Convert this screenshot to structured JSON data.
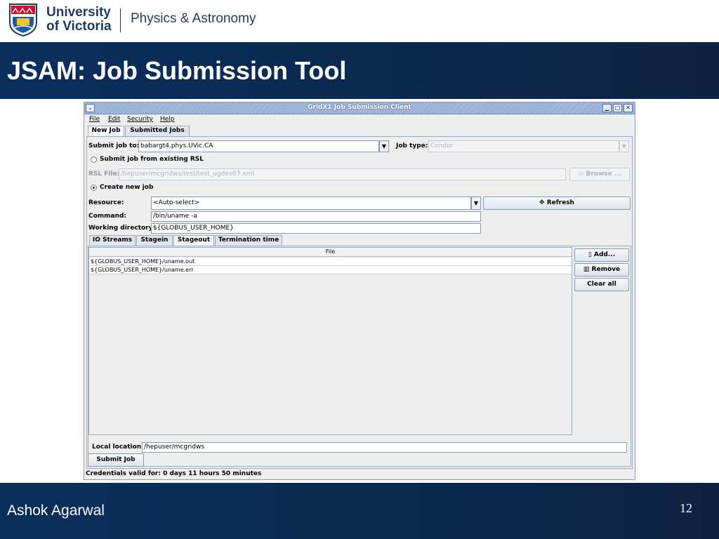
{
  "slide": {
    "logo": {
      "line1": "University",
      "line2": "of Victoria",
      "department": "Physics & Astronomy"
    },
    "title": "JSAM: Job Submission Tool",
    "presenter": "Ashok Agarwal",
    "page_number": "12",
    "colors": {
      "band": "#0b2a50",
      "logo_text": "#1f3a5f"
    }
  },
  "window": {
    "title": "GridX1 Job Submission Client",
    "controls": {
      "minimize": "▁",
      "maximize": "□",
      "close": "✕"
    },
    "menu": [
      "File",
      "Edit",
      "Security",
      "Help"
    ],
    "top_tabs": [
      "New Job",
      "Submitted Jobs"
    ],
    "submit_to": {
      "label": "Submit job to:",
      "value": "babargt4.phys.UVic.CA"
    },
    "job_type": {
      "label": "Job type:",
      "value": "Condor"
    },
    "rsl_radio": {
      "label": "Submit job from existing RSL",
      "selected": false
    },
    "rsl_file": {
      "label": "RSL File:",
      "value": "/hepuser/mcgridws/test/test_ugdev07.xml"
    },
    "browse_button": "Browse ...",
    "create_radio": {
      "label": "Create new job",
      "selected": true
    },
    "resource": {
      "label": "Resource:",
      "value": "<Auto-select>"
    },
    "refresh_button": "Refresh",
    "command": {
      "label": "Command:",
      "value": "/bin/uname -a"
    },
    "working_dir": {
      "label": "Working directory:",
      "value": "${GLOBUS_USER_HOME}"
    },
    "inner_tabs": [
      "IO Streams",
      "Stagein",
      "Stageout",
      "Termination time"
    ],
    "active_inner_tab": "Stageout",
    "file_table": {
      "header": "File",
      "rows": [
        "${GLOBUS_USER_HOME}/uname.out",
        "${GLOBUS_USER_HOME}/uname.err"
      ]
    },
    "side_buttons": {
      "add": "Add...",
      "remove": "Remove",
      "clear": "Clear all"
    },
    "local_location": {
      "label": "Local location:",
      "value": "/hepuser/mcgridws"
    },
    "submit_button": "Submit Job",
    "status": "Credentials valid for: 0 days 11 hours 50 minutes"
  }
}
